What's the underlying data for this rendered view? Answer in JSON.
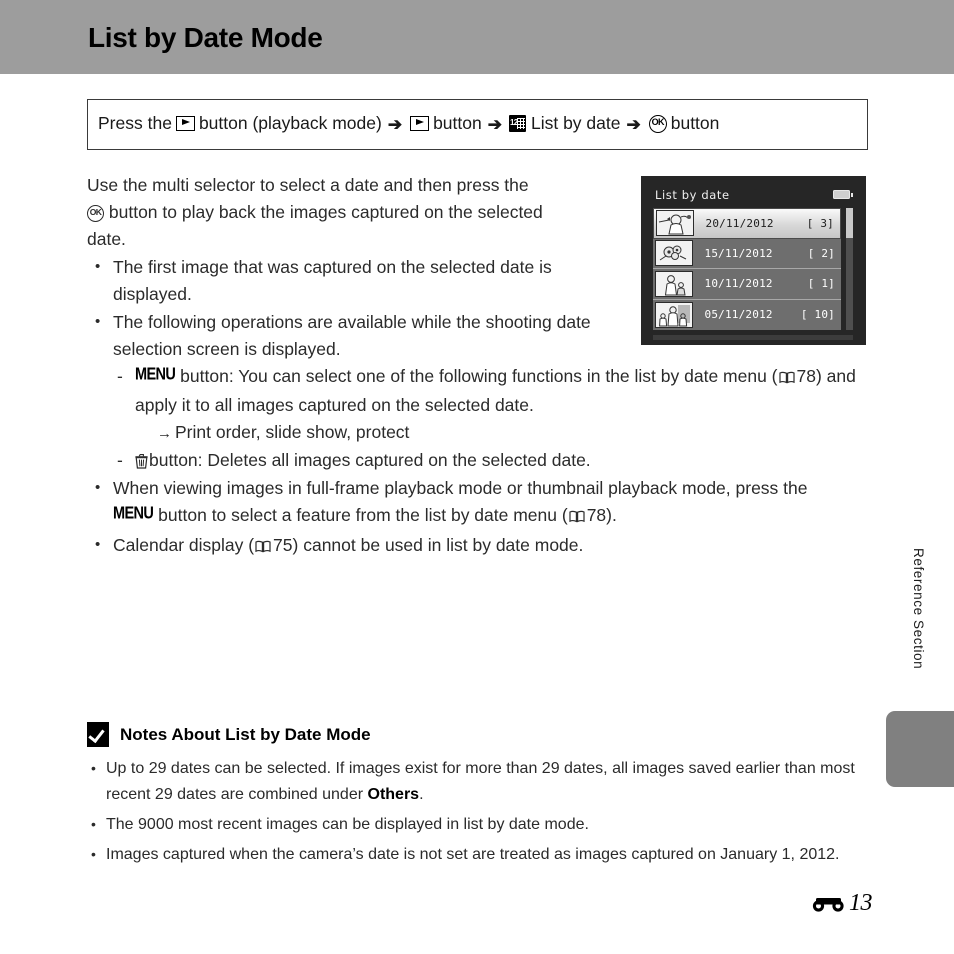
{
  "header": {
    "title": "List by Date Mode"
  },
  "nav_path": {
    "prefix": "Press the",
    "seg1_after_icon": "button (playback mode)",
    "seg2_after_icon": "button",
    "seg3_after_icon": "List by date",
    "seg4_after_icon": "button",
    "icons": {
      "playback": "playback-icon",
      "arrow": "➔",
      "calendar": "calendar-12-icon",
      "ok": "ok-button-icon"
    },
    "calendar_number": "12",
    "ok_label": "OK"
  },
  "intro": {
    "line1": "Use the multi selector to select a date and then press the",
    "line2_after_ok": "button to play back the images captured on the selected",
    "line3": "date."
  },
  "bullets": [
    {
      "text": "The first image that was captured on the selected date is displayed."
    },
    {
      "text": "The following operations are available while the shooting date selection screen is displayed.",
      "subs": [
        {
          "prefix_icon": "MENU",
          "text_a": "button: You can select one of the following functions in the list by date menu (",
          "ref_page": "78",
          "text_b": ") and apply it to all images captured on the selected date.",
          "arrow_note": "Print order, slide show, protect"
        },
        {
          "prefix_icon": "trash-icon",
          "text_a": "button: Deletes all images captured on the selected date."
        }
      ]
    },
    {
      "text_a": "When viewing images in full-frame playback mode or thumbnail playback mode, press the",
      "menu_label": "MENU",
      "text_b": "button to select a feature from the list by date menu (",
      "ref_page": "78",
      "text_c": ")."
    },
    {
      "text_a": "Calendar display (",
      "ref_page": "75",
      "text_b": ") cannot be used in list by date mode."
    }
  ],
  "camera_screen": {
    "title": "List by date",
    "battery_icon": "battery-icon",
    "rows": [
      {
        "date": "20/11/2012",
        "count": "[     3]",
        "selected": true
      },
      {
        "date": "15/11/2012",
        "count": "[     2]",
        "selected": false
      },
      {
        "date": "10/11/2012",
        "count": "[     1]",
        "selected": false
      },
      {
        "date": "05/11/2012",
        "count": "[   10]",
        "selected": false
      }
    ]
  },
  "side": {
    "vertical_label": "Reference Section"
  },
  "notes": {
    "title": "Notes About List by Date Mode",
    "caution_icon": "caution-checkmark-icon",
    "items": [
      {
        "text_a": "Up to 29 dates can be selected. If images exist for more than 29 dates, all images saved earlier than most recent 29 dates are combined under ",
        "bold": "Others",
        "text_b": "."
      },
      {
        "text_a": "The 9000 most recent images can be displayed in list by date mode."
      },
      {
        "text_a": "Images captured when the camera’s date is not set are treated as images captured on January 1, 2012."
      }
    ]
  },
  "footer": {
    "section_icon": "section-e-icon",
    "page_number": "13"
  }
}
